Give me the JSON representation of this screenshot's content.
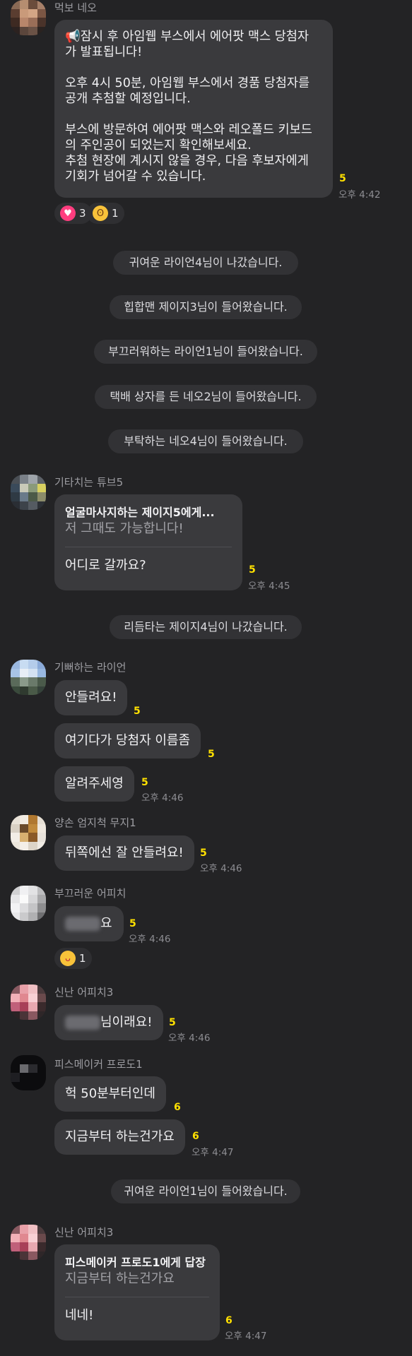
{
  "messages": {
    "m1": {
      "sender": "먹보 네오",
      "lines": [
        "📢잠시 후 아임웹 부스에서 에어팟 맥스 당첨자",
        "가 발표됩니다!",
        "",
        "오후 4시 50분, 아임웹 부스에서 경품 당첨자를",
        "공개 추첨할 예정입니다.",
        "",
        "부스에 방문하여 에어팟 맥스와 레오폴드 키보드",
        "의 주인공이 되었는지 확인해보세요.",
        "추첨 현장에 계시지 않을 경우, 다음 후보자에게",
        "기회가 넘어갈 수 있습니다."
      ],
      "unread": "5",
      "time": "오후 4:42",
      "reactions": [
        {
          "icon": "heart-icon",
          "count": "3",
          "color": "#ff3d7f"
        },
        {
          "icon": "surprised-face-icon",
          "count": "1",
          "color": "#f8c23a"
        }
      ]
    },
    "system1": "귀여운 라이언4님이 나갔습니다.",
    "system2": "힙합맨 제이지3님이 들어왔습니다.",
    "system3": "부끄러워하는 라이언1님이 들어왔습니다.",
    "system4": "택배 상자를 든 네오2님이 들어왔습니다.",
    "system5": "부탁하는 네오4님이 들어왔습니다.",
    "m2": {
      "sender": "기타치는 튜브5",
      "reply_to": "얼굴마사지하는 제이지5에게...",
      "reply_quote": "저 그때도 가능합니다!",
      "text": "어디로 갈까요?",
      "unread": "5",
      "time": "오후 4:45"
    },
    "system6": "리듬타는 제이지4님이 나갔습니다.",
    "m3": {
      "sender": "기뻐하는 라이언",
      "bubbles": [
        {
          "text": "안들려요!",
          "unread": "5"
        },
        {
          "text": "여기다가 당첨자 이름좀",
          "unread": "5"
        },
        {
          "text": "알려주세영",
          "unread": "5",
          "time": "오후 4:46"
        }
      ]
    },
    "m4": {
      "sender": "양손 엄지척 무지1",
      "text": "뒤쪽에선 잘 안들려요!",
      "unread": "5",
      "time": "오후 4:46"
    },
    "m5": {
      "sender": "부끄러운 어피치",
      "text": "요",
      "unread": "5",
      "time": "오후 4:46",
      "reactions": [
        {
          "icon": "tongue-face-icon",
          "count": "1",
          "color": "#f8c23a"
        }
      ]
    },
    "m6": {
      "sender": "신난 어피치3",
      "text": "님이래요!",
      "unread": "5",
      "time": "오후 4:46"
    },
    "m7": {
      "sender": "피스메이커 프로도1",
      "bubbles": [
        {
          "text": "헉 50분부터인데",
          "unread": "6"
        },
        {
          "text": "지금부터 하는건가요",
          "unread": "6",
          "time": "오후 4:47"
        }
      ]
    },
    "system7": "귀여운 라이언1님이 들어왔습니다.",
    "m8": {
      "sender": "신난 어피치3",
      "reply_to": "피스메이커 프로도1에게 답장",
      "reply_quote": "지금부터 하는건가요",
      "text": "네네!",
      "unread": "6",
      "time": "오후 4:47"
    }
  }
}
